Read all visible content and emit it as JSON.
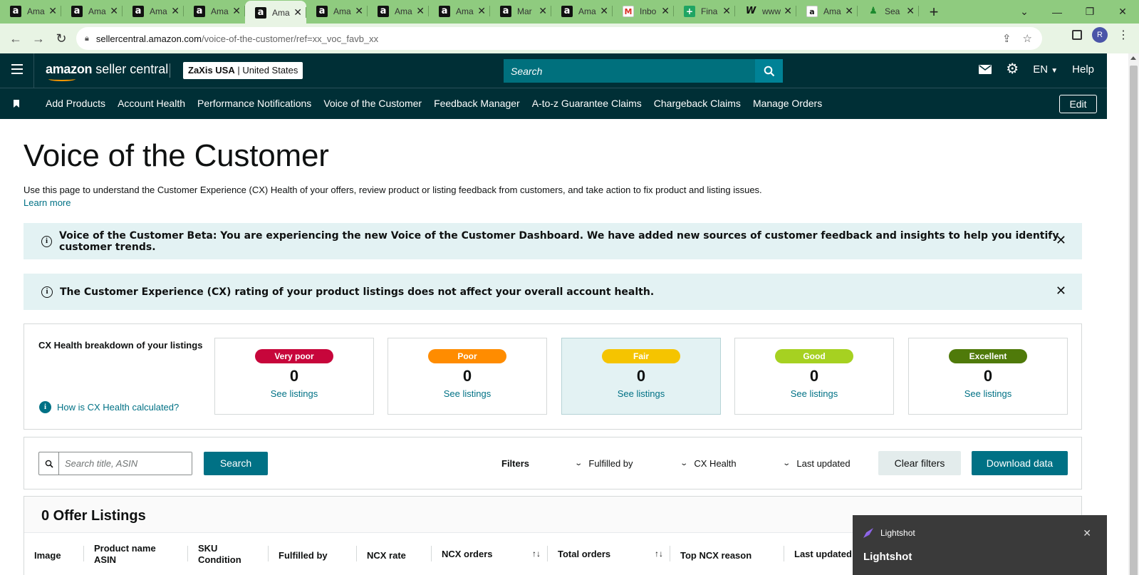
{
  "browser": {
    "tabs": [
      {
        "title": "Ama",
        "icon": "amazon-icon",
        "favicon_letter": "a"
      },
      {
        "title": "Ama",
        "icon": "amazon-icon",
        "favicon_letter": "a"
      },
      {
        "title": "Ama",
        "icon": "amazon-icon",
        "favicon_letter": "a"
      },
      {
        "title": "Ama",
        "icon": "amazon-icon",
        "favicon_letter": "a"
      },
      {
        "title": "Ama",
        "icon": "amazon-icon",
        "favicon_letter": "a",
        "active": true
      },
      {
        "title": "Ama",
        "icon": "amazon-icon",
        "favicon_letter": "a"
      },
      {
        "title": "Ama",
        "icon": "amazon-icon",
        "favicon_letter": "a"
      },
      {
        "title": "Ama",
        "icon": "amazon-icon",
        "favicon_letter": "a"
      },
      {
        "title": "Mar",
        "icon": "amazon-icon",
        "favicon_letter": "a"
      },
      {
        "title": "Ama",
        "icon": "amazon-icon",
        "favicon_letter": "a"
      },
      {
        "title": "Inbo",
        "icon": "gmail-icon",
        "favicon_letter": "M"
      },
      {
        "title": "Fina",
        "icon": "sheets-icon",
        "favicon_letter": "+"
      },
      {
        "title": "www",
        "icon": "wix-icon",
        "favicon_letter": "W"
      },
      {
        "title": "Ama",
        "icon": "amazon-icon",
        "favicon_letter": "a"
      },
      {
        "title": "Sea",
        "icon": "person-icon",
        "favicon_letter": "♟"
      }
    ],
    "new_tab_glyph": "+",
    "url_host": "sellercentral.amazon.com",
    "url_path": "/voice-of-the-customer/ref=xx_voc_favb_xx",
    "avatar_letter": "R",
    "tab_strip_color": "#8fcb7f"
  },
  "header": {
    "logo_amazon": "amazon",
    "logo_rest": " seller central",
    "account_store": "ZaXis USA",
    "account_region": "United States",
    "search_placeholder": "Search",
    "language": "EN",
    "help": "Help",
    "bg_color": "#002f36"
  },
  "nav": {
    "items": [
      "Add Products",
      "Account Health",
      "Performance Notifications",
      "Voice of the Customer",
      "Feedback Manager",
      "A-to-z Guarantee Claims",
      "Chargeback Claims",
      "Manage Orders"
    ],
    "edit": "Edit"
  },
  "page": {
    "title": "Voice of the Customer",
    "description": "Use this page to understand the Customer Experience (CX) Health of your offers, review product or listing feedback from customers, and take action to fix product and listing issues.",
    "learn_more": "Learn more",
    "banner_beta": "Voice of the Customer Beta: You are experiencing the new Voice of the Customer Dashboard. We have added new sources of customer feedback and insights to help you identify customer trends.",
    "banner_rating": "The Customer Experience (CX) rating of your product listings does not affect your overall account health."
  },
  "cx": {
    "label": "CX Health breakdown of your listings",
    "how": "How is CX Health calculated?",
    "cards": [
      {
        "label": "Very poor",
        "count": "0",
        "link": "See listings",
        "color": "#c7063b"
      },
      {
        "label": "Poor",
        "count": "0",
        "link": "See listings",
        "color": "#ff8c00"
      },
      {
        "label": "Fair",
        "count": "0",
        "link": "See listings",
        "color": "#f5c400",
        "selected": true
      },
      {
        "label": "Good",
        "count": "0",
        "link": "See listings",
        "color": "#a6d121"
      },
      {
        "label": "Excellent",
        "count": "0",
        "link": "See listings",
        "color": "#4f7a0a"
      }
    ]
  },
  "filters": {
    "search_placeholder": "Search title, ASIN",
    "search_button": "Search",
    "label": "Filters",
    "fulfilled_by": "Fulfilled by",
    "cx_health": "CX Health",
    "last_updated": "Last updated",
    "clear": "Clear filters",
    "download": "Download data"
  },
  "listings": {
    "title": "0 Offer Listings",
    "columns": {
      "image": "Image",
      "product_name": "Product name",
      "asin": "ASIN",
      "sku": "SKU",
      "condition": "Condition",
      "fulfilled_by": "Fulfilled by",
      "ncx_rate": "NCX rate",
      "ncx_orders": "NCX orders",
      "total_orders": "Total orders",
      "top_ncx_reason": "Top NCX reason",
      "last_updated": "Last updated"
    }
  },
  "lightshot": {
    "app": "Lightshot",
    "title": "Lightshot"
  }
}
